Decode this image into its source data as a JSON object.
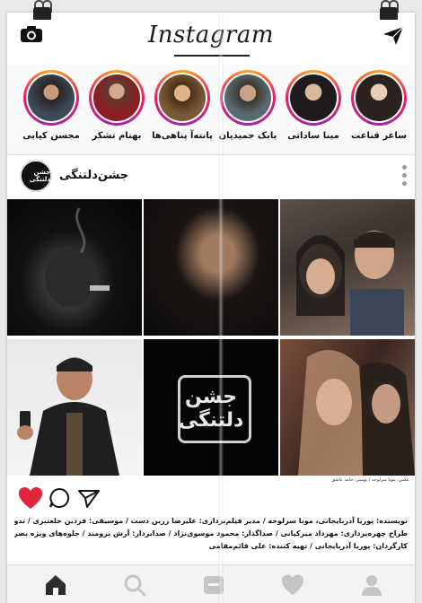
{
  "header": {
    "logo": "Instagram"
  },
  "stories": [
    {
      "name": "ساغر قناعت",
      "color": "#3b2a25"
    },
    {
      "name": "مینا ساداتی",
      "color": "#2f2a2c"
    },
    {
      "name": "بابک حمیدیان",
      "color": "#4a4138"
    },
    {
      "name": "پانته‌آ پناهی‌ها",
      "color": "#6b4a2c"
    },
    {
      "name": "بهنام تشکر",
      "color": "#3a2f2e"
    },
    {
      "name": "محسن کیایی",
      "color": "#3c4a58"
    }
  ],
  "post": {
    "account_name": "جشن‌دلتنگی",
    "avatar_text": "جشن دلتنگی",
    "center_logo": "جشن دلتنگی",
    "photo_credit": "عکس: مونا سرلوحه / پوستر: حامد عاشق",
    "credits": [
      "نویسنده: پوریا آذربایجانی، مونا سرلوحه / مدیر فیلم‌برداری: علیرضا زرین دست / موسیقی: فردین خلعتبری / تدوین: خشایار موحدیان",
      "طراح چهره‌پردازی: مهرداد میرکیانی / صداگذار: محمود موسوی‌نژاد / صدابردار: آرش برومند / جلوه‌های ویژه بصری: بهنام خاکسار",
      "کارگردان: پوریا آذربایجانی / تهیه کننده: علی قائم‌مقامی"
    ]
  },
  "colors": {
    "like_red": "#e0263a",
    "nav_grey": "#c4c4c4",
    "nav_home": "#2d2d2d"
  },
  "icons": [
    "camera-icon",
    "send-icon",
    "heart-icon",
    "comment-icon",
    "share-icon",
    "home-icon",
    "search-icon",
    "tv-icon",
    "activity-heart-icon",
    "profile-icon"
  ]
}
